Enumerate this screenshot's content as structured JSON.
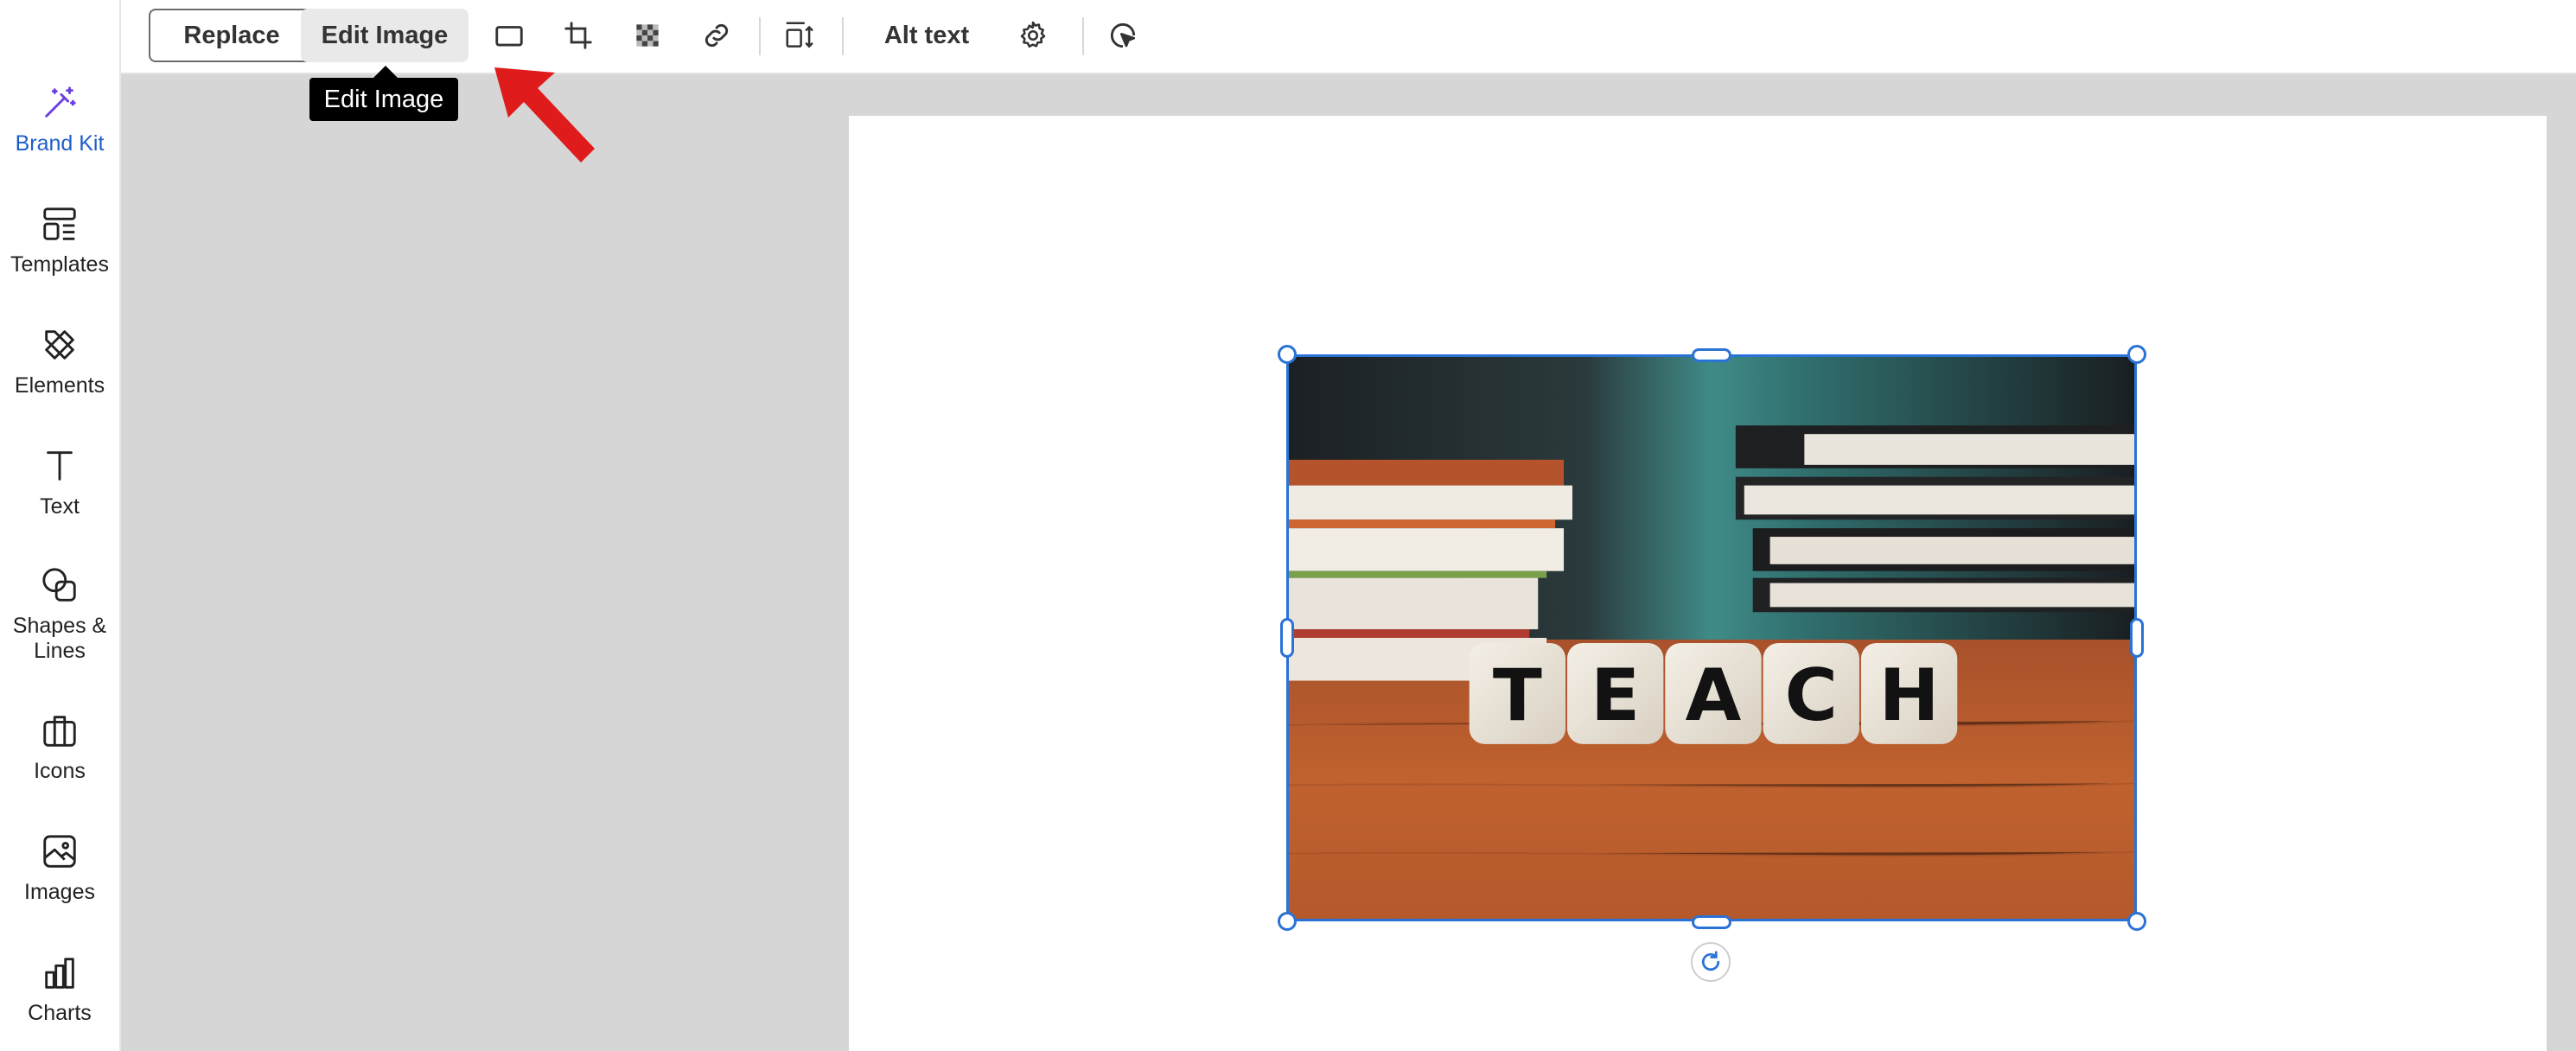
{
  "sidebar": {
    "items": [
      {
        "label": "Brand Kit",
        "icon": "magic-wand-icon",
        "active": true
      },
      {
        "label": "Templates",
        "icon": "templates-icon"
      },
      {
        "label": "Elements",
        "icon": "elements-icon"
      },
      {
        "label": "Text",
        "icon": "text-icon"
      },
      {
        "label": "Shapes &\nLines",
        "icon": "shapes-icon"
      },
      {
        "label": "Icons",
        "icon": "briefcase-icon"
      },
      {
        "label": "Images",
        "icon": "image-icon"
      },
      {
        "label": "Charts",
        "icon": "bar-chart-icon"
      }
    ]
  },
  "toolbar": {
    "replace_label": "Replace",
    "edit_image_label": "Edit Image",
    "alt_text_label": "Alt text",
    "icons": [
      "border-icon",
      "crop-icon",
      "transparency-icon",
      "link-icon",
      "align-size-icon",
      "settings-icon",
      "interaction-icon"
    ]
  },
  "tooltip": {
    "text": "Edit Image"
  },
  "canvas": {
    "image": {
      "subject": "dice-teach-books-photo",
      "letters": [
        "T",
        "E",
        "A",
        "C",
        "H"
      ]
    }
  },
  "colors": {
    "accent": "#1e5ec8",
    "selection": "#2a73d6",
    "annotation_arrow": "#e01b1b",
    "canvas_bg": "#d6d6d6"
  }
}
